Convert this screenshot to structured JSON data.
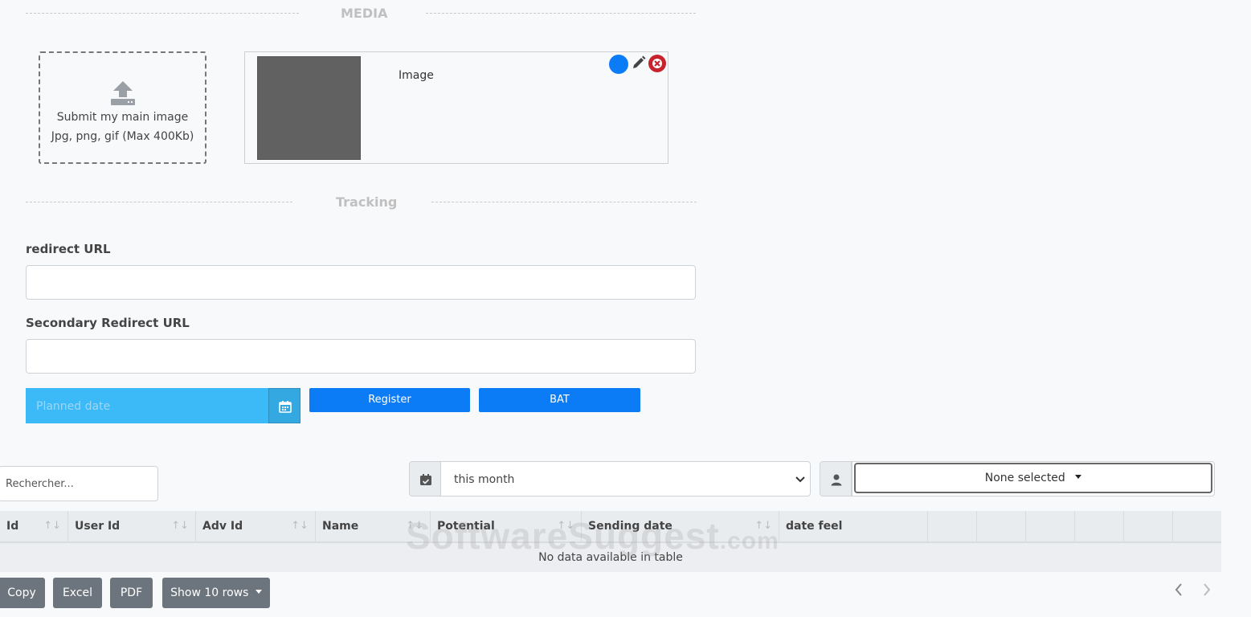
{
  "media_section": {
    "title": "MEDIA"
  },
  "upload": {
    "line1": "Submit my main image",
    "line2": "Jpg, png, gif (Max 400Kb)"
  },
  "image_card": {
    "label": "Image"
  },
  "tracking_section": {
    "title": "Tracking"
  },
  "redirect": {
    "label": "redirect URL",
    "value": ""
  },
  "secondary_redirect": {
    "label": "Secondary Redirect URL",
    "value": ""
  },
  "planned_date": {
    "placeholder": "Planned date"
  },
  "buttons": {
    "register": "Register",
    "bat": "BAT"
  },
  "search": {
    "placeholder": "Rechercher..."
  },
  "period_select": {
    "selected": "this month"
  },
  "user_multiselect": {
    "selected": "None selected"
  },
  "table": {
    "columns": [
      "Id",
      "User Id",
      "Adv Id",
      "Name",
      "Potential",
      "Sending date",
      "date feel"
    ],
    "empty_message": "No data available in table"
  },
  "watermark": {
    "main": "SoftwareSuggest",
    "suffix": ".com"
  },
  "footer_buttons": {
    "copy": "Copy",
    "excel": "Excel",
    "pdf": "PDF",
    "rows": "Show 10 rows"
  },
  "colors": {
    "primary": "#0b7cf5",
    "date_input": "#3cb9f7",
    "danger": "#c8232c",
    "secondary": "#6c757d"
  }
}
